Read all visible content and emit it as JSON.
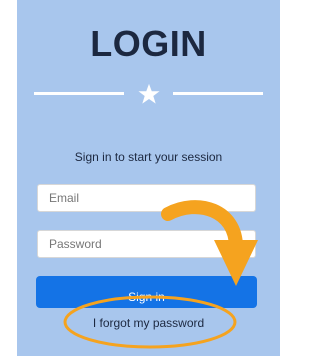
{
  "login": {
    "title": "LOGIN",
    "subtitle": "Sign in to start your session",
    "email_placeholder": "Email",
    "password_placeholder": "Password",
    "signin_label": "Sign in",
    "forgot_label": "I forgot my password"
  },
  "colors": {
    "panel_background": "#a8c6ed",
    "primary_button": "#1473e6",
    "annotation_orange": "#f5a31f"
  },
  "icons": {
    "divider_center": "star-icon",
    "annotation": "curved-arrow-icon"
  }
}
